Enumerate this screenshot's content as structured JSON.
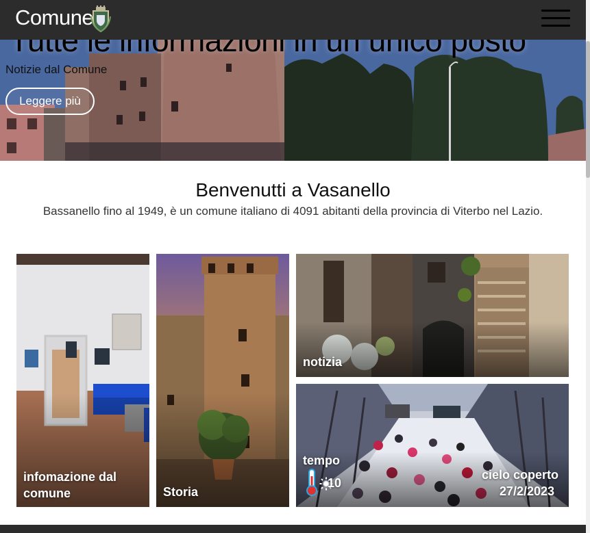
{
  "navbar": {
    "brand": "Comune",
    "logo_icon": "coat-of-arms-icon",
    "menu_icon": "hamburger-menu-icon"
  },
  "hero": {
    "title": "Tutte le informazioni in un unico posto",
    "subtitle": "Notizie dal Comune",
    "button_label": "Leggere più"
  },
  "welcome": {
    "title": "Benvenutti a Vasanello",
    "description": "Bassanello fino al 1949, è un comune italiano di 4091 abitanti della provincia di Viterbo nel Lazio."
  },
  "tiles": [
    {
      "label_line1": "infomazione dal",
      "label_line2": "comune"
    },
    {
      "label": "Storia"
    },
    {
      "label": "notizia"
    },
    {
      "label": "tempo"
    }
  ],
  "weather": {
    "temperature": "10",
    "condition": "cielo coperto",
    "date": "27/2/2023",
    "thermometer_icon": "thermometer-icon",
    "weather_icon": "sun-icon"
  },
  "colors": {
    "navbar": "#2c2c2c",
    "hero_sky": "#3c5a92",
    "text_white": "#ffffff"
  }
}
